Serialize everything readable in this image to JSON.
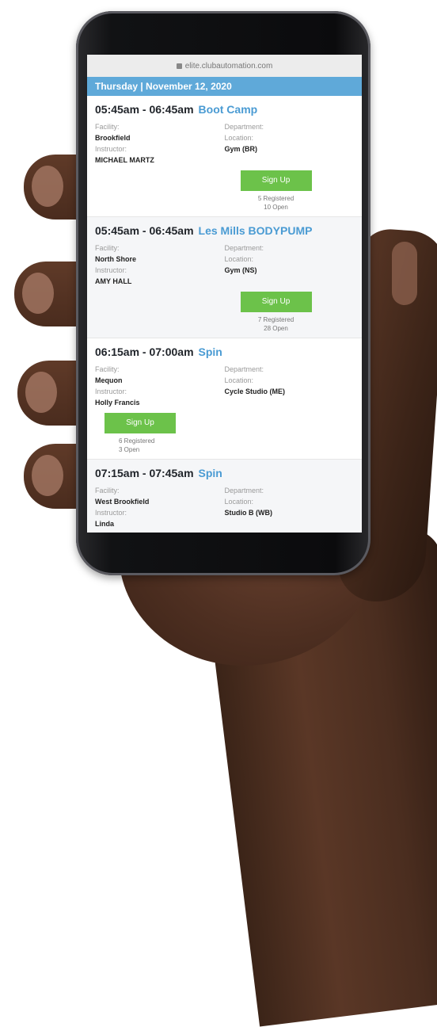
{
  "browser": {
    "url": "elite.clubautomation.com"
  },
  "schedule": {
    "date": "Thursday | November 12, 2020",
    "labels": {
      "facility": "Facility:",
      "department": "Department:",
      "instructor": "Instructor:",
      "location": "Location:"
    },
    "classes": [
      {
        "time": "05:45am - 06:45am",
        "name": "Boot Camp",
        "facility": "Brookfield",
        "location": "Gym (BR)",
        "instructor": "MICHAEL MARTZ",
        "button": "Sign Up",
        "registered": "5 Registered",
        "open": "10 Open"
      },
      {
        "time": "05:45am - 06:45am",
        "name": "Les Mills BODYPUMP",
        "facility": "North Shore",
        "location": "Gym (NS)",
        "instructor": "AMY HALL",
        "button": "Sign Up",
        "registered": "7 Registered",
        "open": "28 Open"
      },
      {
        "time": "06:15am - 07:00am",
        "name": "Spin",
        "facility": "Mequon",
        "location": "Cycle Studio (ME)",
        "instructor": "Holly Francis",
        "button": "Sign Up",
        "registered": "6 Registered",
        "open": "3 Open"
      },
      {
        "time": "07:15am - 07:45am",
        "name": "Spin",
        "facility": "West Brookfield",
        "location": "Studio B (WB)",
        "instructor": "Linda"
      }
    ]
  },
  "colors": {
    "header_blue": "#5fa9d9",
    "class_name_blue": "#4a9bd3",
    "button_green": "#6cc24a"
  }
}
